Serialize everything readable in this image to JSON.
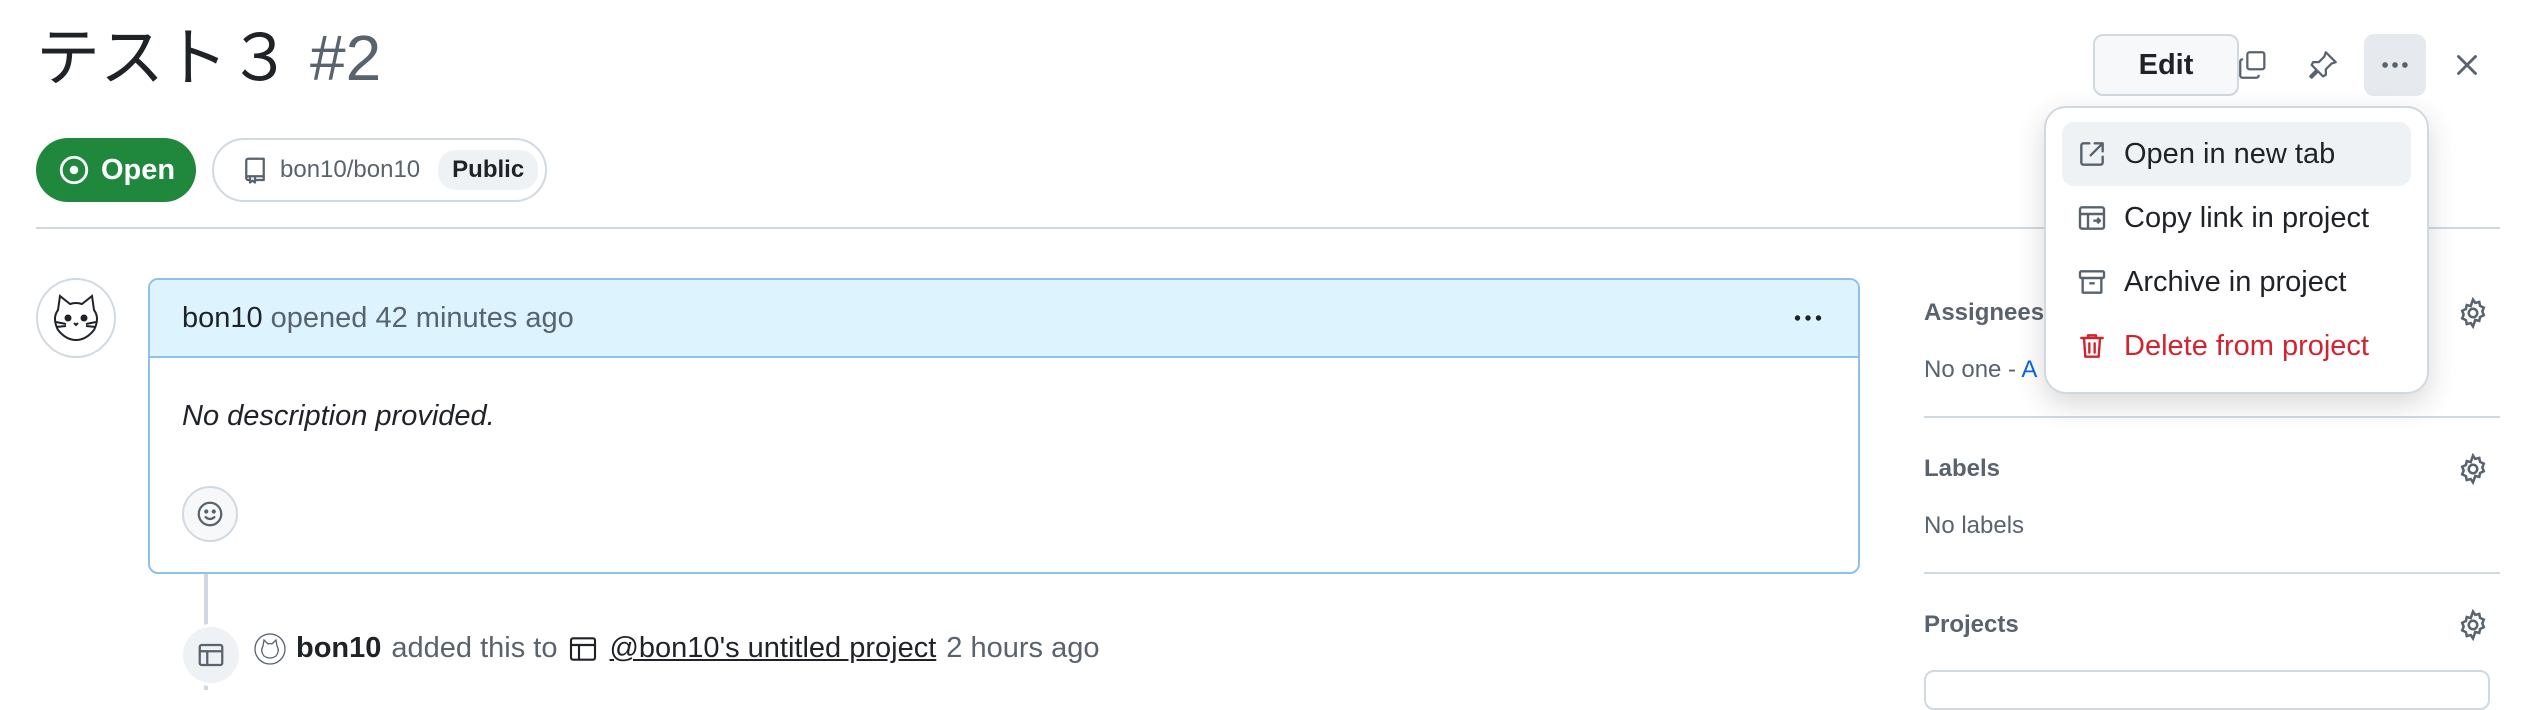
{
  "issue": {
    "title": "テスト３",
    "number": "#2",
    "state": "Open",
    "repo": "bon10/bon10",
    "visibility": "Public"
  },
  "header_actions": {
    "edit_label": "Edit",
    "icons": [
      "copy-icon",
      "pin-icon",
      "kebab-icon",
      "close-icon"
    ]
  },
  "comment": {
    "author": "bon10",
    "meta": "opened 42 minutes ago",
    "body": "No description provided."
  },
  "timeline": {
    "actor": "bon10",
    "action": "added this to",
    "project": "@bon10's untitled project",
    "time": "2 hours ago"
  },
  "sidebar": {
    "assignees_label": "Assignees",
    "assignees_value": "No one - ",
    "assignees_link": "A",
    "labels_label": "Labels",
    "labels_value": "No labels",
    "projects_label": "Projects"
  },
  "menu": {
    "items": [
      {
        "label": "Open in new tab",
        "icon": "external-link-icon"
      },
      {
        "label": "Copy link in project",
        "icon": "table-link-icon"
      },
      {
        "label": "Archive in project",
        "icon": "archive-icon"
      },
      {
        "label": "Delete from project",
        "icon": "trash-icon",
        "danger": true
      }
    ]
  },
  "colors": {
    "open_green": "#1f883d",
    "comment_header_bg": "#ddf4ff",
    "danger_red": "#d1242f",
    "link_blue": "#0969da"
  }
}
